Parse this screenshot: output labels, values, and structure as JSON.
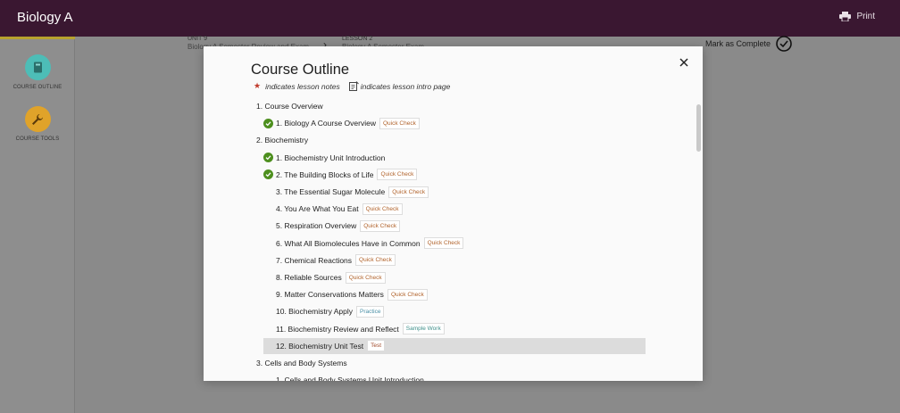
{
  "header": {
    "app_title": "Biology A",
    "print_label": "Print"
  },
  "sidebar": {
    "items": [
      {
        "label": "COURSE OUTLINE",
        "color": "#4dbdb7",
        "icon": "book-icon"
      },
      {
        "label": "COURSE TOOLS",
        "color": "#e0a32a",
        "icon": "wrench-icon"
      }
    ]
  },
  "breadcrumb": {
    "unit_label": "UNIT 9",
    "unit_title": "Biology A Semester Review and Exam",
    "lesson_label": "LESSON 2",
    "lesson_title": "Biology A Semester Exam"
  },
  "mark_complete_label": "Mark as Complete",
  "modal": {
    "title": "Course Outline",
    "legend_notes": "indicates lesson notes",
    "legend_intro": "indicates lesson intro page",
    "star_color": "#c03a2b",
    "check_color": "#4d8f1e",
    "sections": [
      {
        "title": "1. Course Overview",
        "lessons": [
          {
            "title": "1. Biology A Course Overview",
            "tag": "Quick Check",
            "tag_type": "quick",
            "completed": true,
            "selected": false
          }
        ]
      },
      {
        "title": "2. Biochemistry",
        "lessons": [
          {
            "title": "1. Biochemistry Unit Introduction",
            "tag": "",
            "tag_type": "",
            "completed": true,
            "selected": false
          },
          {
            "title": "2. The Building Blocks of Life",
            "tag": "Quick Check",
            "tag_type": "quick",
            "completed": true,
            "selected": false
          },
          {
            "title": "3. The Essential Sugar Molecule",
            "tag": "Quick Check",
            "tag_type": "quick",
            "completed": false,
            "selected": false
          },
          {
            "title": "4. You Are What You Eat",
            "tag": "Quick Check",
            "tag_type": "quick",
            "completed": false,
            "selected": false
          },
          {
            "title": "5. Respiration Overview",
            "tag": "Quick Check",
            "tag_type": "quick",
            "completed": false,
            "selected": false
          },
          {
            "title": "6. What All Biomolecules Have in Common",
            "tag": "Quick Check",
            "tag_type": "quick",
            "completed": false,
            "selected": false
          },
          {
            "title": "7. Chemical Reactions",
            "tag": "Quick Check",
            "tag_type": "quick",
            "completed": false,
            "selected": false
          },
          {
            "title": "8. Reliable Sources",
            "tag": "Quick Check",
            "tag_type": "quick",
            "completed": false,
            "selected": false
          },
          {
            "title": "9. Matter Conservations Matters",
            "tag": "Quick Check",
            "tag_type": "quick",
            "completed": false,
            "selected": false
          },
          {
            "title": "10. Biochemistry Apply",
            "tag": "Practice",
            "tag_type": "practice",
            "completed": false,
            "selected": false
          },
          {
            "title": "11. Biochemistry Review and Reflect",
            "tag": "Sample Work",
            "tag_type": "sample",
            "completed": false,
            "selected": false
          },
          {
            "title": "12. Biochemistry Unit Test",
            "tag": "Test",
            "tag_type": "test",
            "completed": false,
            "selected": true
          }
        ]
      },
      {
        "title": "3. Cells and Body Systems",
        "lessons": [
          {
            "title": "1. Cells and Body Systems Unit Introduction",
            "tag": "",
            "tag_type": "",
            "completed": false,
            "selected": false
          }
        ]
      }
    ]
  }
}
